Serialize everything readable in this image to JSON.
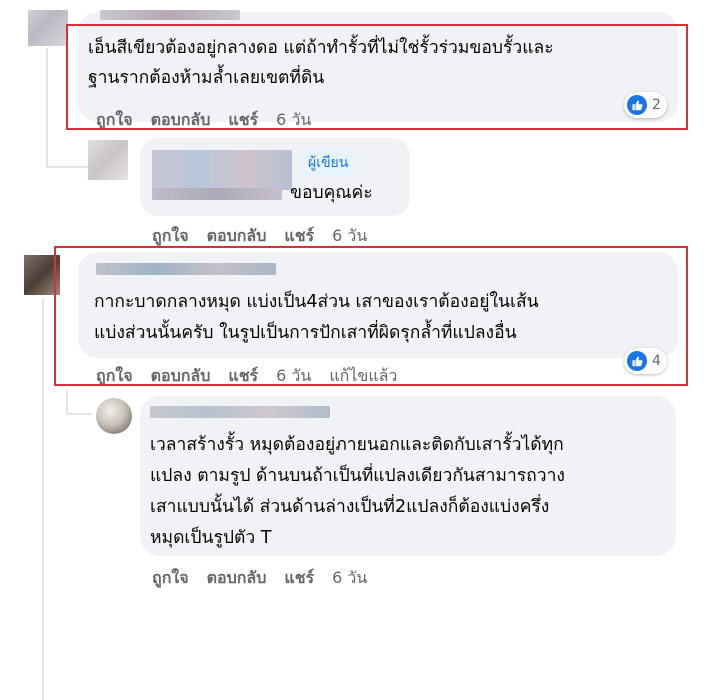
{
  "comments": [
    {
      "text_line1": "เอ็นสีเขียวต้องอยู่กลางดอ แต่ถ้าทำรั้วที่ไม่ใช่รั้วร่วมขอบรั้วและ",
      "text_line2": "ฐานรากต้องห้ามล้ำเลยเขตที่ดิน",
      "like": "ถูกใจ",
      "reply": "ตอบกลับ",
      "share": "แชร์",
      "time": "6 วัน",
      "reaction_count": "2"
    },
    {
      "badge": "ผู้เขียน",
      "text_line1": "ขอบคุณค่ะ",
      "like": "ถูกใจ",
      "reply": "ตอบกลับ",
      "share": "แชร์",
      "time": "6 วัน"
    },
    {
      "text_line1": "กากะบาดกลางหมุด แบ่งเป็น4ส่วน เสาของเราต้องอยู่ในเส้น",
      "text_line2": "แบ่งส่วนนั้นครับ ในรูปเป็นการปักเสาที่ผิดรุกล้ำที่แปลงอื่น",
      "like": "ถูกใจ",
      "reply": "ตอบกลับ",
      "share": "แชร์",
      "time": "6 วัน",
      "edited": "แก้ไขแล้ว",
      "reaction_count": "4"
    },
    {
      "text_line1": "เวลาสร้างรั้ว หมุดต้องอยู่ภายนอกและติดกับเสารั้วได้ทุก",
      "text_line2": "แปลง ตามรูป ด้านบนถ้าเป็นที่แปลงเดียวกันสามารถวาง",
      "text_line3": "เสาแบบนั้นได้ ส่วนด้านล่างเป็นที่2แปลงก็ต้องแบ่งครึ่ง",
      "text_line4": "หมุดเป็นรูปตัว T",
      "like": "ถูกใจ",
      "reply": "ตอบกลับ",
      "share": "แชร์",
      "time": "6 วัน"
    }
  ],
  "icons": {
    "reaction": "like-icon"
  },
  "colors": {
    "highlight": "#d9313a",
    "like_blue": "#1b74e4",
    "bubble": "#f0f2f5"
  }
}
